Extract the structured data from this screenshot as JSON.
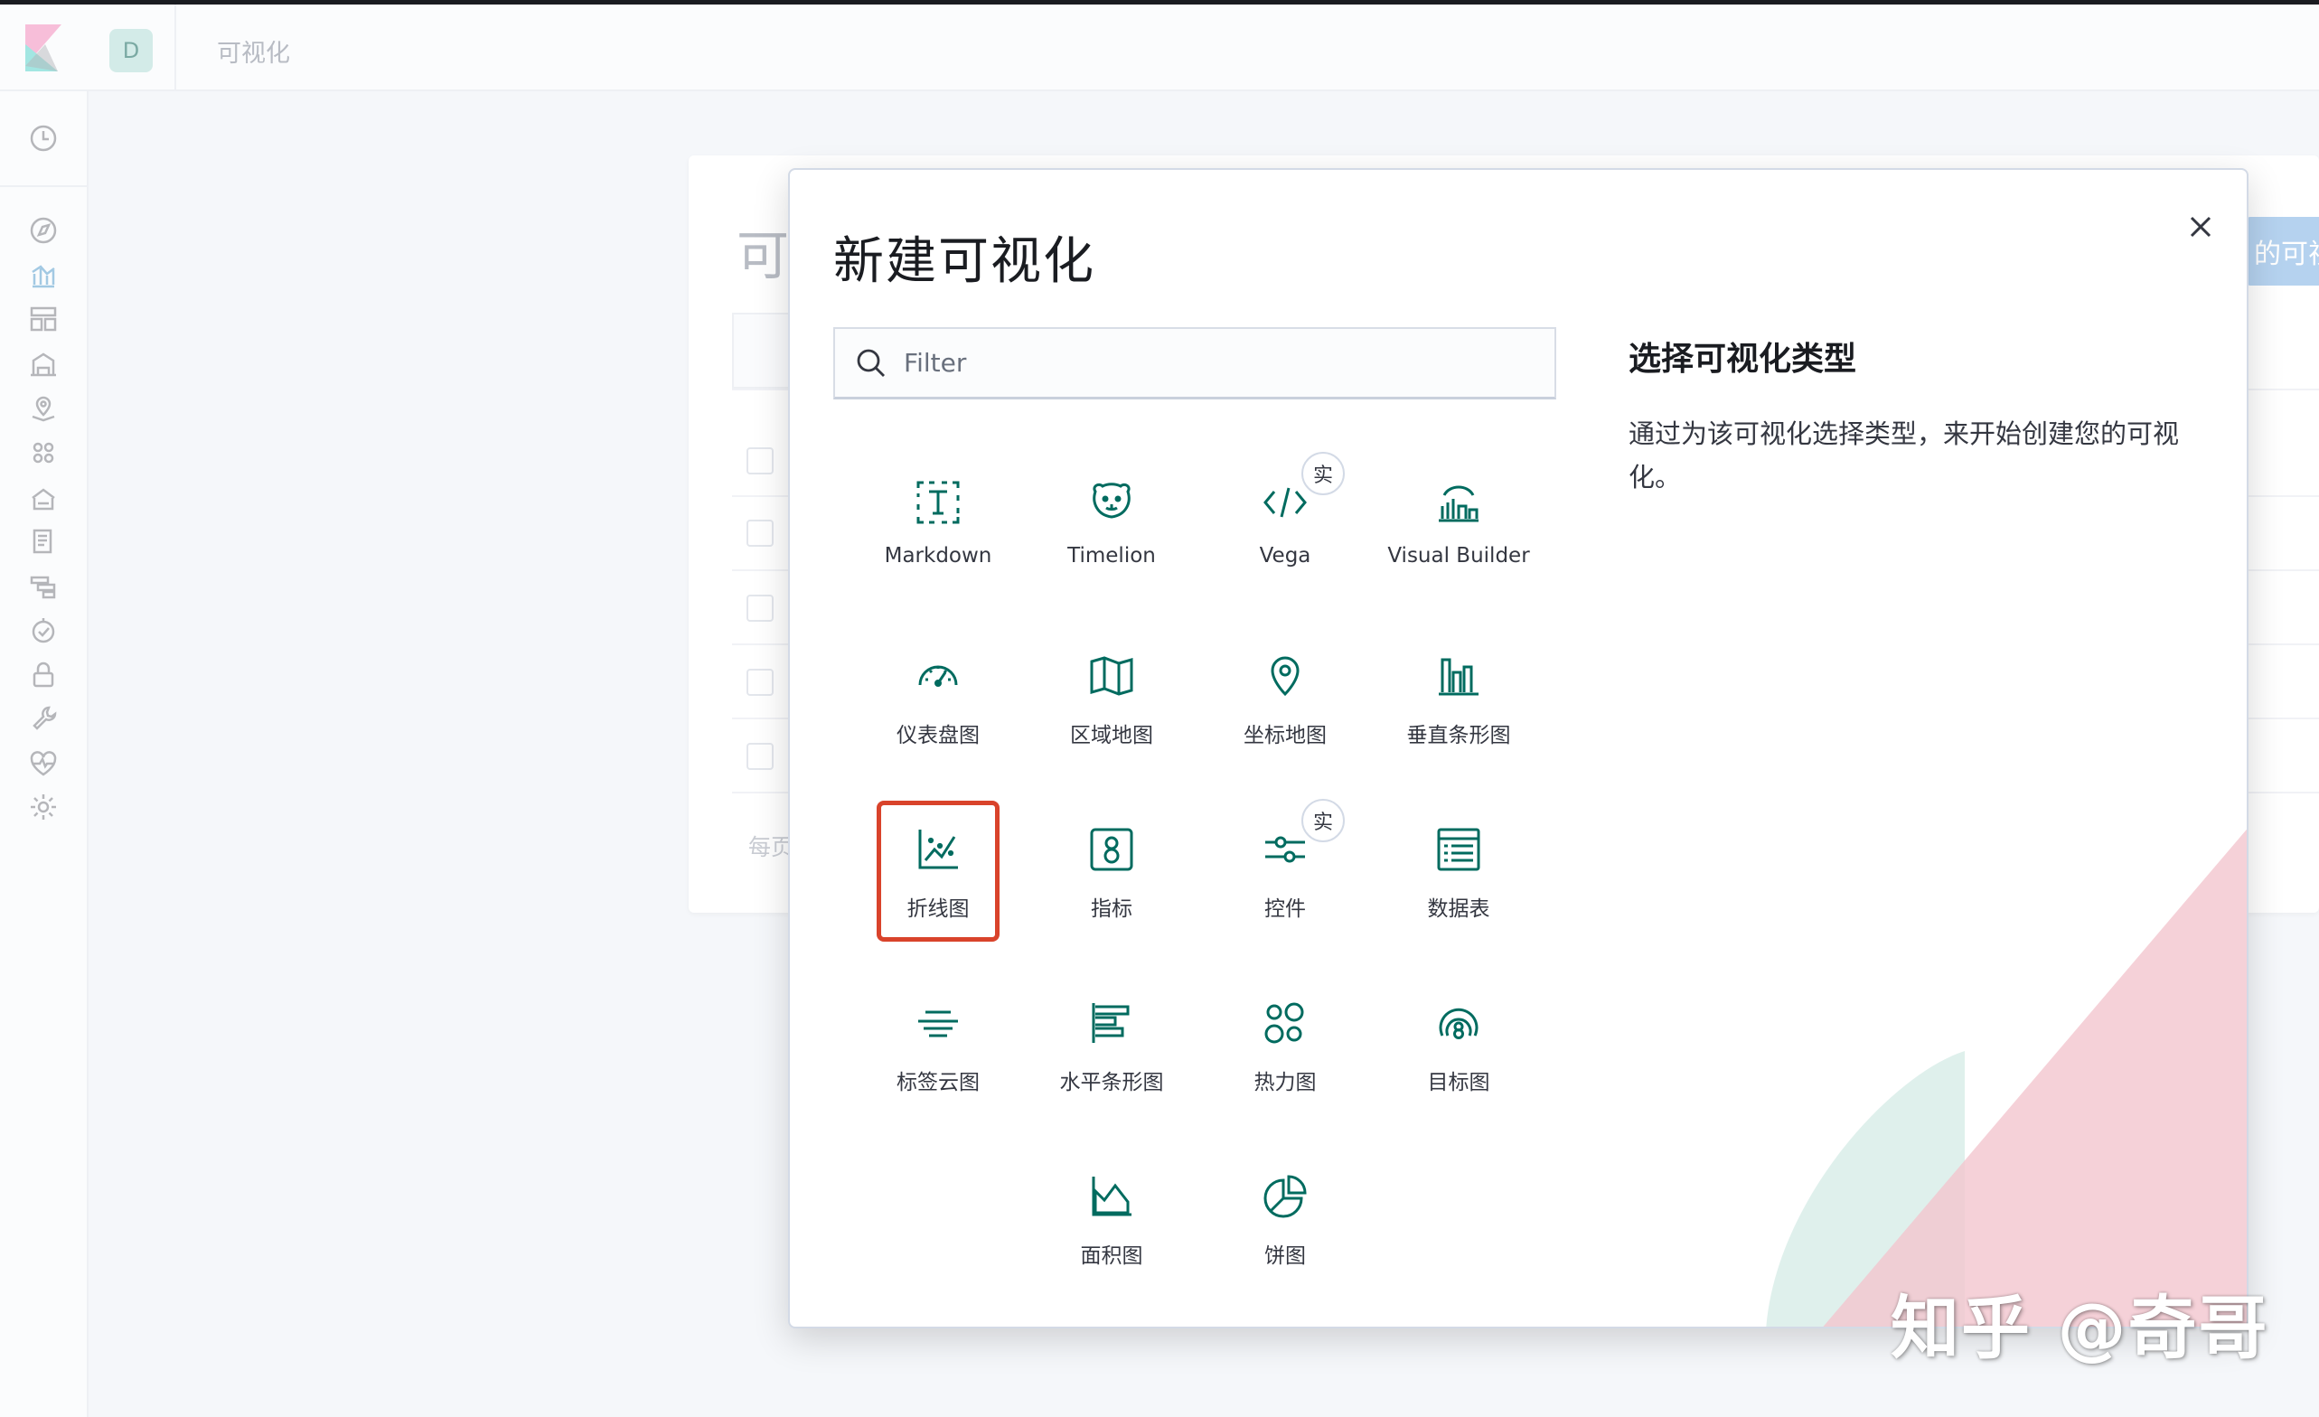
{
  "header": {
    "avatar_letter": "D",
    "breadcrumb": "可视化"
  },
  "background": {
    "title_fragment": "可",
    "button_fragment": "的可视",
    "per_page_fragment": "每页"
  },
  "modal": {
    "title": "新建可视化",
    "filter_placeholder": "Filter",
    "side_title": "选择可视化类型",
    "side_desc": "通过为该可视化选择类型，来开始创建您的可视化。",
    "items": [
      {
        "label": "Markdown",
        "icon": "markdown-icon"
      },
      {
        "label": "Timelion",
        "icon": "timelion-icon"
      },
      {
        "label": "Vega",
        "icon": "code-icon",
        "badge": "实"
      },
      {
        "label": "Visual Builder",
        "icon": "visual-builder-icon"
      },
      {
        "label": "仪表盘图",
        "icon": "gauge-icon"
      },
      {
        "label": "区域地图",
        "icon": "region-map-icon"
      },
      {
        "label": "坐标地图",
        "icon": "map-pin-icon"
      },
      {
        "label": "垂直条形图",
        "icon": "vertical-bar-icon"
      },
      {
        "label": "折线图",
        "icon": "line-chart-icon",
        "selected": true
      },
      {
        "label": "指标",
        "icon": "metric-icon"
      },
      {
        "label": "控件",
        "icon": "controls-icon",
        "badge": "实"
      },
      {
        "label": "数据表",
        "icon": "data-table-icon"
      },
      {
        "label": "标签云图",
        "icon": "tag-cloud-icon"
      },
      {
        "label": "水平条形图",
        "icon": "horizontal-bar-icon"
      },
      {
        "label": "热力图",
        "icon": "heatmap-icon"
      },
      {
        "label": "目标图",
        "icon": "goal-icon"
      },
      {
        "label": "面积图",
        "icon": "area-chart-icon"
      },
      {
        "label": "饼图",
        "icon": "pie-chart-icon"
      }
    ]
  },
  "watermark": "知乎 @奇哥",
  "colors": {
    "accent": "#006b5f",
    "selected_border": "#d9432b"
  }
}
